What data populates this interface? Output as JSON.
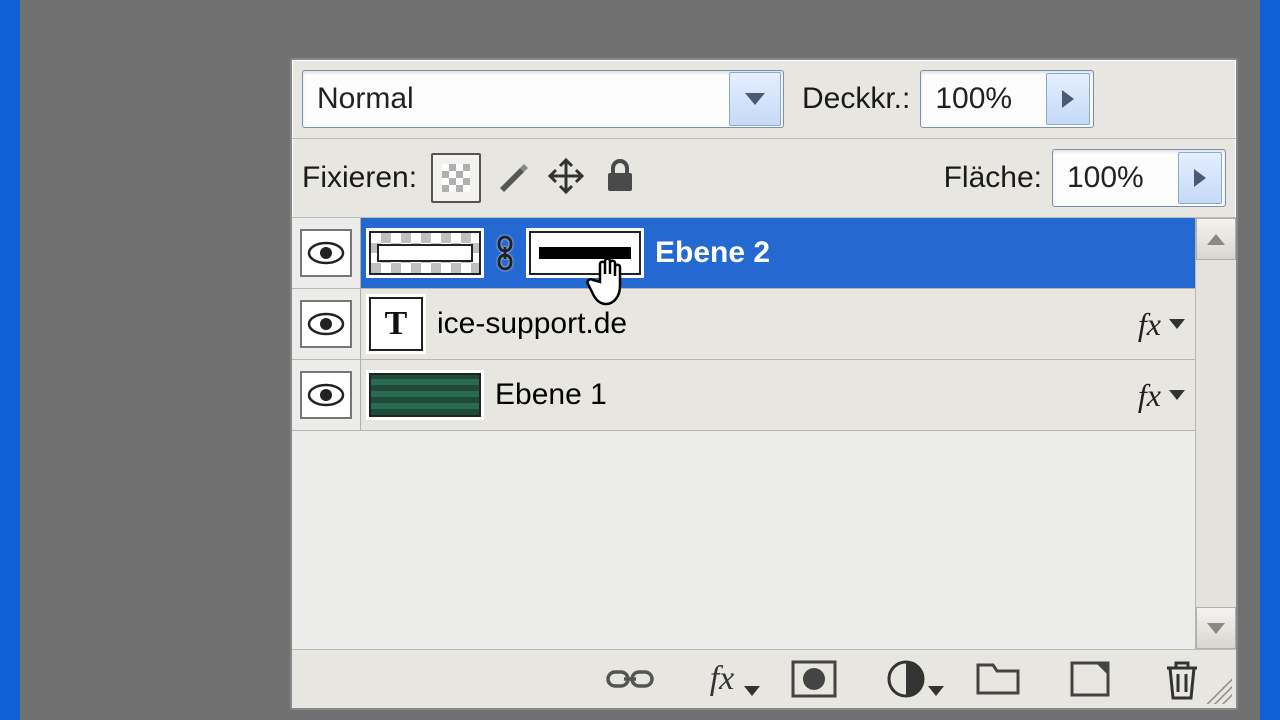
{
  "blend_mode": "Normal",
  "opacity": {
    "label": "Deckkr.:",
    "value": "100%"
  },
  "fill": {
    "label": "Fläche:",
    "value": "100%"
  },
  "lock": {
    "label": "Fixieren:"
  },
  "layers": [
    {
      "name": "Ebene 2",
      "selected": true,
      "has_mask": true,
      "has_fx": false,
      "type": "raster"
    },
    {
      "name": "ice-support.de",
      "selected": false,
      "has_mask": false,
      "has_fx": true,
      "type": "text"
    },
    {
      "name": "Ebene 1",
      "selected": false,
      "has_mask": false,
      "has_fx": true,
      "type": "raster"
    }
  ],
  "fx_label": "fx",
  "icons": {
    "link": "link-icon",
    "fx": "fx-icon",
    "mask": "add-mask-icon",
    "adjust": "adjustment-icon",
    "group": "new-group-icon",
    "newlayer": "new-layer-icon",
    "trash": "trash-icon"
  }
}
